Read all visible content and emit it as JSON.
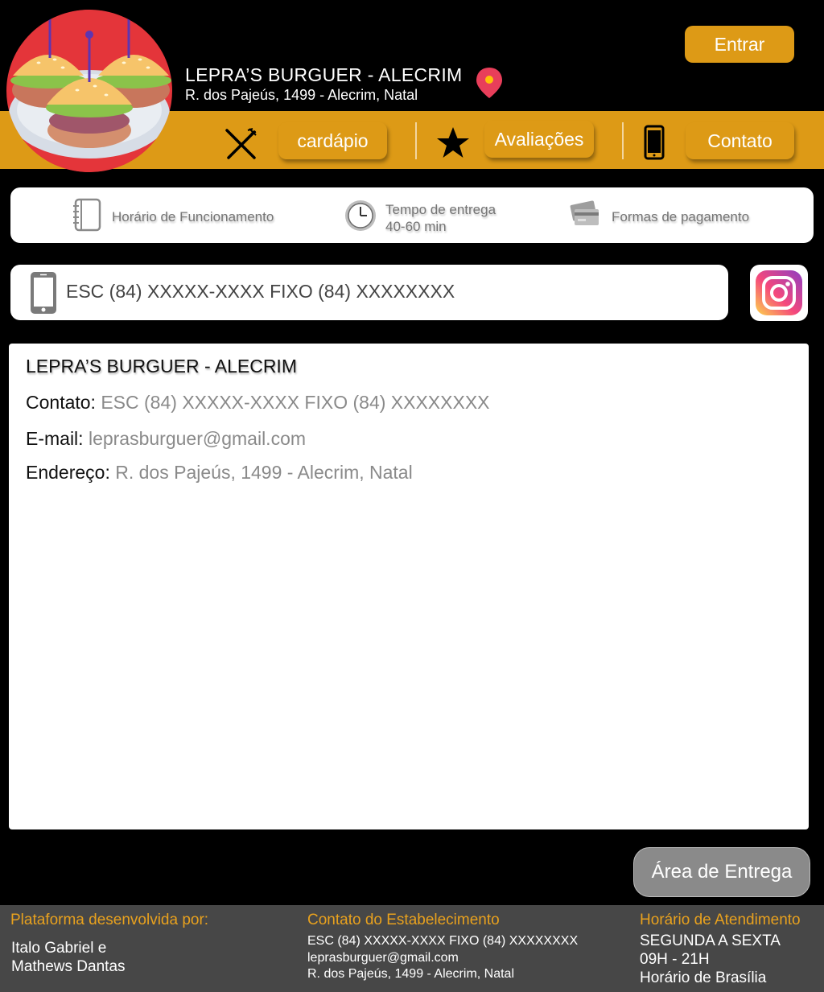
{
  "header": {
    "restaurant_name": "LEPRA’S BURGUER - ALECRIM",
    "address": "R. dos Pajeús, 1499 - Alecrim, Natal",
    "login_label": "Entrar"
  },
  "nav": {
    "menu_label": "cardápio",
    "reviews_label": "Avaliações",
    "contact_label": "Contato"
  },
  "info": {
    "hours_label": "Horário de Funcionamento",
    "delivery_label": "Tempo de entrega",
    "delivery_time": "40-60 min",
    "payment_label": "Formas de pagamento"
  },
  "phone_bar": {
    "text": "ESC (84) XXXXX-XXXX FIXO (84) XXXXXXXX"
  },
  "panel": {
    "title": "LEPRA’S BURGUER - ALECRIM",
    "contact_key": "Contato:",
    "contact_value": "ESC (84) XXXXX-XXXX FIXO (84) XXXXXXXX",
    "email_key": "E-mail:",
    "email_value": "leprasburguer@gmail.com",
    "address_key": "Endereço:",
    "address_value": "R. dos Pajeús, 1499 - Alecrim, Natal"
  },
  "delivery_area_label": "Área de Entrega",
  "footer": {
    "dev_heading": "Plataforma desenvolvida por:",
    "dev_line1": "Italo Gabriel e",
    "dev_line2": "Mathews Dantas",
    "contact_heading": "Contato do Estabelecimento",
    "contact_phone": "ESC (84) XXXXX-XXXX FIXO (84) XXXXXXXX",
    "contact_email": "leprasburguer@gmail.com",
    "contact_address": "R. dos Pajeús, 1499 - Alecrim, Natal",
    "hours_heading": "Horário de Atendimento",
    "hours_days": "SEGUNDA A SEXTA",
    "hours_time": "09H - 21H",
    "hours_tz": "Horário de Brasília"
  },
  "colors": {
    "accent": "#dd9a16",
    "background": "#000000",
    "footer": "#474747",
    "footer_heading": "#e8a11e"
  },
  "icons": [
    "burger-logo-icon",
    "map-pin-icon",
    "cutlery-icon",
    "star-icon",
    "phone-icon",
    "notebook-icon",
    "clock-icon",
    "credit-cards-icon",
    "instagram-icon"
  ]
}
